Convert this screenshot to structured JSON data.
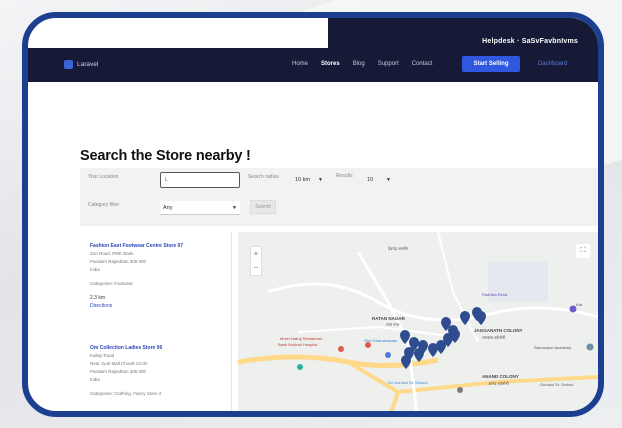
{
  "navbar": {
    "brand": "Laravel",
    "top_strip_text": "Helpdesk · SaSvFavbnIvms",
    "links": [
      "Home",
      "Stores",
      "Blog",
      "Support",
      "Contact"
    ],
    "active_link": "Stores",
    "cta_label": "Start Selling",
    "extra_link": "Dashboard"
  },
  "page_title": "Search the Store nearby !",
  "filters": {
    "your_location_label": "Your Location",
    "location_value": "L",
    "search_radius_label": "Search radius",
    "radius_value": "10 km",
    "results_label": "Results",
    "results_value": "10",
    "category_label": "Category filter",
    "category_value": "Any",
    "search_button": "Submit"
  },
  "results": [
    {
      "name": "Fashion East Footwear Centre Store 07",
      "lines": [
        "Zoo Road, PMK Bank",
        "Pandarri Rajasthan 305 000",
        "India"
      ],
      "category": "Categories: Footwear",
      "distance": "2.3 km",
      "directions": "Directions"
    },
    {
      "name": "Om Collection Ladies Store 06",
      "lines": [
        "Kailay Road",
        "Near Jyoti Mall Chowk Circle",
        "Pandarri Rajasthan 305 000",
        "India"
      ],
      "category": "Categories: Clothing, Fancy Store 2",
      "distance": "",
      "directions": ""
    }
  ],
  "map": {
    "zoom_in": "+",
    "zoom_out": "−",
    "fullscreen": "⛶",
    "labels": [
      {
        "text": "देवगढ़ अजमेर",
        "cls": ""
      },
      {
        "text": "RATAN NAGAR",
        "cls": "bold"
      },
      {
        "text": "रतन नगर",
        "cls": ""
      },
      {
        "text": "JAGGANATH COLONY",
        "cls": "bold"
      },
      {
        "text": "जगन्नाथ कॉलोनी",
        "cls": ""
      },
      {
        "text": "Motel Natraj Restaurant",
        "cls": ""
      },
      {
        "text": "Bank Nukkad Hospital",
        "cls": ""
      },
      {
        "text": "ANAND COLONY",
        "cls": "bold"
      },
      {
        "text": "आनंद कॉलोनी",
        "cls": ""
      },
      {
        "text": "Shiv Dharamshala",
        "cls": ""
      },
      {
        "text": "Ramanpuri Academy",
        "cls": ""
      },
      {
        "text": "Gurukul Sr. School",
        "cls": ""
      },
      {
        "text": "Sri Gurukul Sr. School",
        "cls": ""
      },
      {
        "text": "Radhika Reha",
        "cls": ""
      },
      {
        "text": "Kat",
        "cls": ""
      }
    ]
  },
  "colors": {
    "frame": "#1d3f8f",
    "navbar": "#161a36",
    "cta": "#2f57e0",
    "link": "#2a45b6",
    "pin": "#2f4d8e",
    "road": "#ffd98a"
  }
}
